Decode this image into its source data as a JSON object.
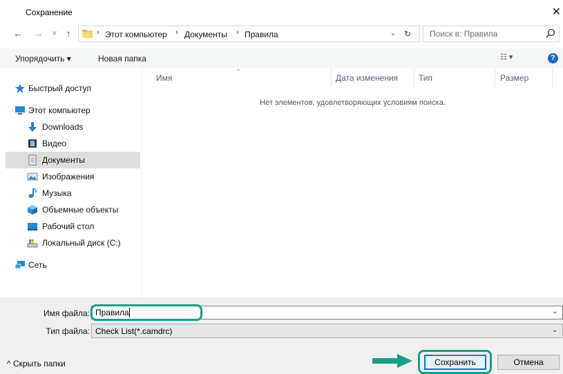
{
  "window": {
    "title": "Сохранение",
    "close_glyph": "✕"
  },
  "nav": {
    "back_glyph": "←",
    "forward_glyph": "→",
    "recent_glyph": "˅",
    "up_glyph": "↑",
    "breadcrumbs": [
      "Этот компьютер",
      "Документы",
      "Правила"
    ],
    "crumb_sep": "›",
    "dropdown_glyph": "⌄",
    "refresh_glyph": "↻",
    "search_placeholder": "Поиск в: Правила"
  },
  "toolbar": {
    "organize_label": "Упорядочить ▾",
    "new_folder_label": "Новая папка",
    "view_glyph": "☷ ▾",
    "help_glyph": "?"
  },
  "sidebar": {
    "items": [
      {
        "label": "Быстрый доступ",
        "icon": "star-pin-icon"
      },
      {
        "label": "Этот компьютер",
        "icon": "computer-icon"
      },
      {
        "label": "Downloads",
        "icon": "download-icon"
      },
      {
        "label": "Видео",
        "icon": "video-icon"
      },
      {
        "label": "Документы",
        "icon": "documents-icon",
        "selected": true
      },
      {
        "label": "Изображения",
        "icon": "pictures-icon"
      },
      {
        "label": "Музыка",
        "icon": "music-icon"
      },
      {
        "label": "Объемные объекты",
        "icon": "3d-objects-icon"
      },
      {
        "label": "Рабочий стол",
        "icon": "desktop-icon"
      },
      {
        "label": "Локальный диск (C:)",
        "icon": "drive-icon"
      },
      {
        "label": "Сеть",
        "icon": "network-icon"
      }
    ]
  },
  "filelist": {
    "columns": [
      "Имя",
      "Дата изменения",
      "Тип",
      "Размер"
    ],
    "sort_glyph": "^",
    "empty_message": "Нет элементов, удовлетворяющих условиям поиска."
  },
  "form": {
    "filename_label": "Имя файла:",
    "filename_value": "Правила",
    "filetype_label": "Тип файла:",
    "filetype_value": "Check List(*.camdrc)",
    "dropdown_glyph": "⌄"
  },
  "footer": {
    "hide_folders_label": "^  Скрыть папки",
    "save_label": "Сохранить",
    "cancel_label": "Отмена"
  },
  "colors": {
    "highlight": "#14a085",
    "accent": "#0078d7",
    "selected_bg": "#dedede"
  }
}
